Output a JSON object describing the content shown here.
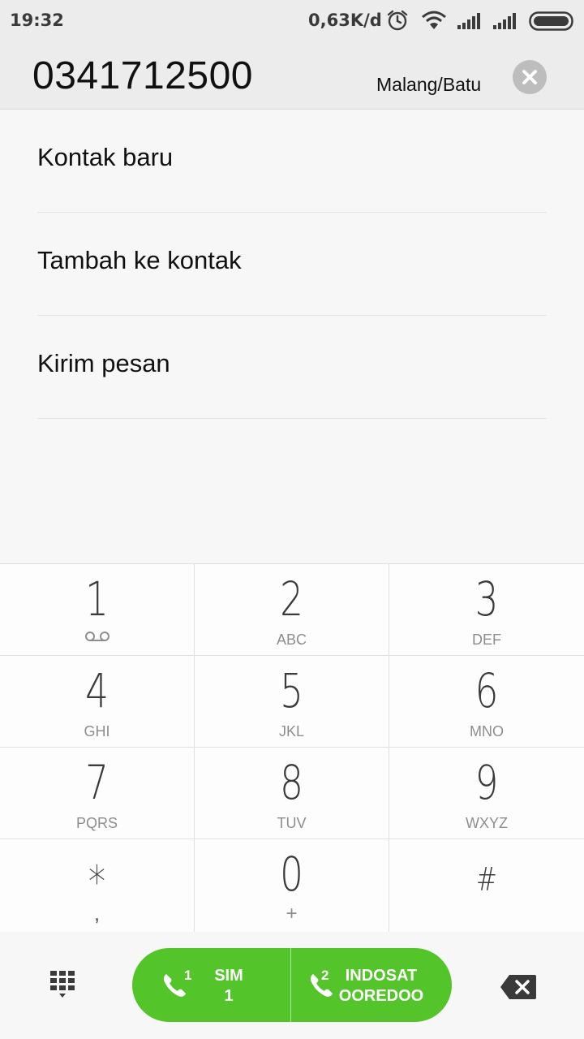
{
  "status_bar": {
    "time": "19:32",
    "net_speed": "0,63K/d",
    "icons": [
      "alarm-icon",
      "wifi-icon",
      "signal-sim1-icon",
      "signal-sim2-icon",
      "battery-icon"
    ]
  },
  "header": {
    "number": "0341712500",
    "location": "Malang/Batu",
    "clear_icon": "clear-icon"
  },
  "options": [
    {
      "label": "Kontak baru"
    },
    {
      "label": "Tambah ke kontak"
    },
    {
      "label": "Kirim pesan"
    }
  ],
  "keypad": {
    "keys": [
      {
        "digit": "1",
        "letters": ""
      },
      {
        "digit": "2",
        "letters": "ABC"
      },
      {
        "digit": "3",
        "letters": "DEF"
      },
      {
        "digit": "4",
        "letters": "GHI"
      },
      {
        "digit": "5",
        "letters": "JKL"
      },
      {
        "digit": "6",
        "letters": "MNO"
      },
      {
        "digit": "7",
        "letters": "PQRS"
      },
      {
        "digit": "8",
        "letters": "TUV"
      },
      {
        "digit": "9",
        "letters": "WXYZ"
      },
      {
        "digit": "*",
        "letters": ","
      },
      {
        "digit": "0",
        "letters": "+"
      },
      {
        "digit": "#",
        "letters": ""
      }
    ],
    "voicemail_icon": "voicemail-icon"
  },
  "call_bar": {
    "sim1_badge": "1",
    "sim1_line1": "SIM",
    "sim1_line2": "1",
    "sim2_badge": "2",
    "sim2_line1": "INDOSAT",
    "sim2_line2": "OOREDOO",
    "accent_color": "#53c42a"
  }
}
